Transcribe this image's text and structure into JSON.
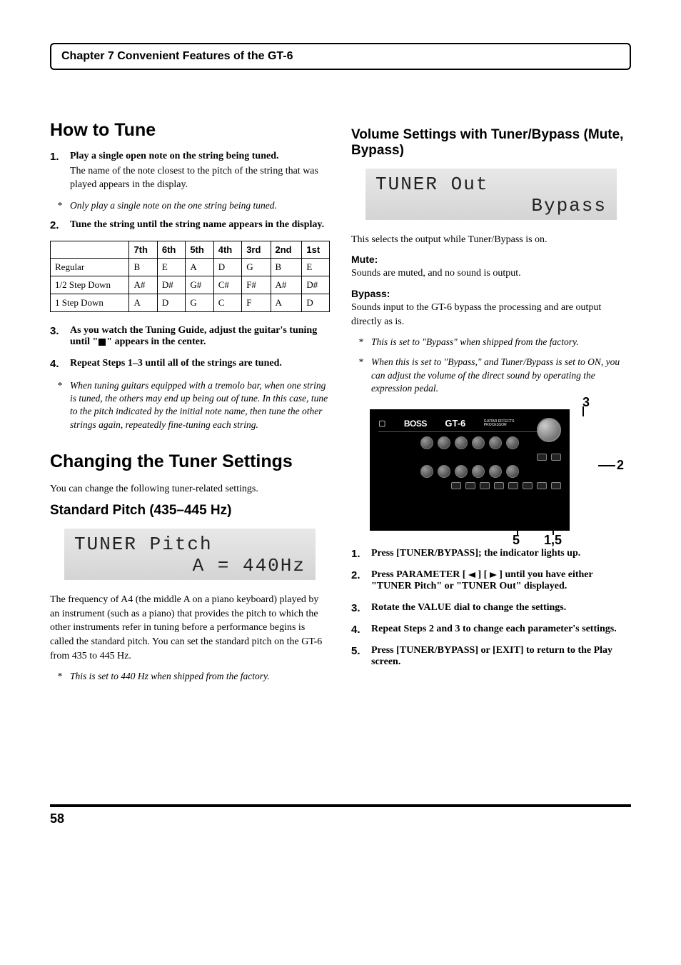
{
  "chapter_header": "Chapter 7 Convenient Features of the GT-6",
  "page_number": "58",
  "left": {
    "h1_howtune": "How to Tune",
    "step1": "Play a single open note on the string being tuned.",
    "step1_sub": "The name of the note closest to the pitch of the string that was played appears in the display.",
    "note1": "Only play a single note on the one string being tuned.",
    "step2": "Tune the string until the string name appears in the display.",
    "table": {
      "headers": [
        "",
        "7th",
        "6th",
        "5th",
        "4th",
        "3rd",
        "2nd",
        "1st"
      ],
      "rows": [
        {
          "label": "Regular",
          "cells": [
            "B",
            "E",
            "A",
            "D",
            "G",
            "B",
            "E"
          ]
        },
        {
          "label": "1/2 Step Down",
          "cells": [
            "A#",
            "D#",
            "G#",
            "C#",
            "F#",
            "A#",
            "D#"
          ]
        },
        {
          "label": "1 Step Down",
          "cells": [
            "A",
            "D",
            "G",
            "C",
            "F",
            "A",
            "D"
          ]
        }
      ]
    },
    "step3_pre": "As you watch the Tuning Guide, adjust the guitar's tuning until \"",
    "step3_post": "\" appears in the center.",
    "step4": "Repeat Steps 1–3 until all of the strings are tuned.",
    "note2": "When tuning guitars equipped with a tremolo bar, when one string is tuned, the others may end up being out of tune. In this case, tune to the pitch indicated by the initial note name, then tune the other strings again, repeatedly fine-tuning each string.",
    "h1_changing": "Changing the Tuner Settings",
    "changing_para": "You can change the following tuner-related settings.",
    "h2_pitch": "Standard Pitch (435–445 Hz)",
    "lcd_pitch_line1": "TUNER Pitch",
    "lcd_pitch_line2": "A = 440Hz",
    "pitch_para": "The frequency of A4 (the middle A on a piano keyboard) played by an instrument (such as a piano) that provides the pitch to which the other instruments refer in tuning before a performance begins is called the standard pitch. You can set the standard pitch on the GT-6 from 435 to 445 Hz.",
    "pitch_note": "This is set to 440 Hz when shipped from the factory."
  },
  "right": {
    "h2_volume": "Volume Settings with Tuner/Bypass (Mute, Bypass)",
    "lcd_out_line1": "TUNER Out",
    "lcd_out_line2": "Bypass",
    "out_para": "This selects the output while Tuner/Bypass is on.",
    "mute_head": "Mute:",
    "mute_body": " Sounds are muted, and no sound is output.",
    "bypass_head": "Bypass:",
    "bypass_body": "Sounds input to the GT-6 bypass the processing and are output directly as is.",
    "bypass_note1": "This is set to \"Bypass\" when shipped from the factory.",
    "bypass_note2": "When this is set to \"Bypass,\" and Tuner/Bypass is set to ON, you can adjust the volume of the direct sound by operating the expression pedal.",
    "device": {
      "logo": "BOSS",
      "model": "GT-6",
      "model_sub": "GUITAR EFFECTS\nPROCESSOR"
    },
    "callouts": {
      "c3": "3",
      "c2": "2",
      "c5": "5",
      "c15": "1,5"
    },
    "r_step1": "Press [TUNER/BYPASS]; the indicator lights up.",
    "r_step2_pre": "Press PARAMETER [ ",
    "r_step2_mid": " ] [ ",
    "r_step2_post": " ] until you have either \"TUNER Pitch\" or \"TUNER Out\" displayed.",
    "r_step3": "Rotate the VALUE dial to change the settings.",
    "r_step4": "Repeat Steps 2 and 3 to change each parameter's settings.",
    "r_step5": "Press [TUNER/BYPASS] or [EXIT] to return to the Play screen."
  }
}
